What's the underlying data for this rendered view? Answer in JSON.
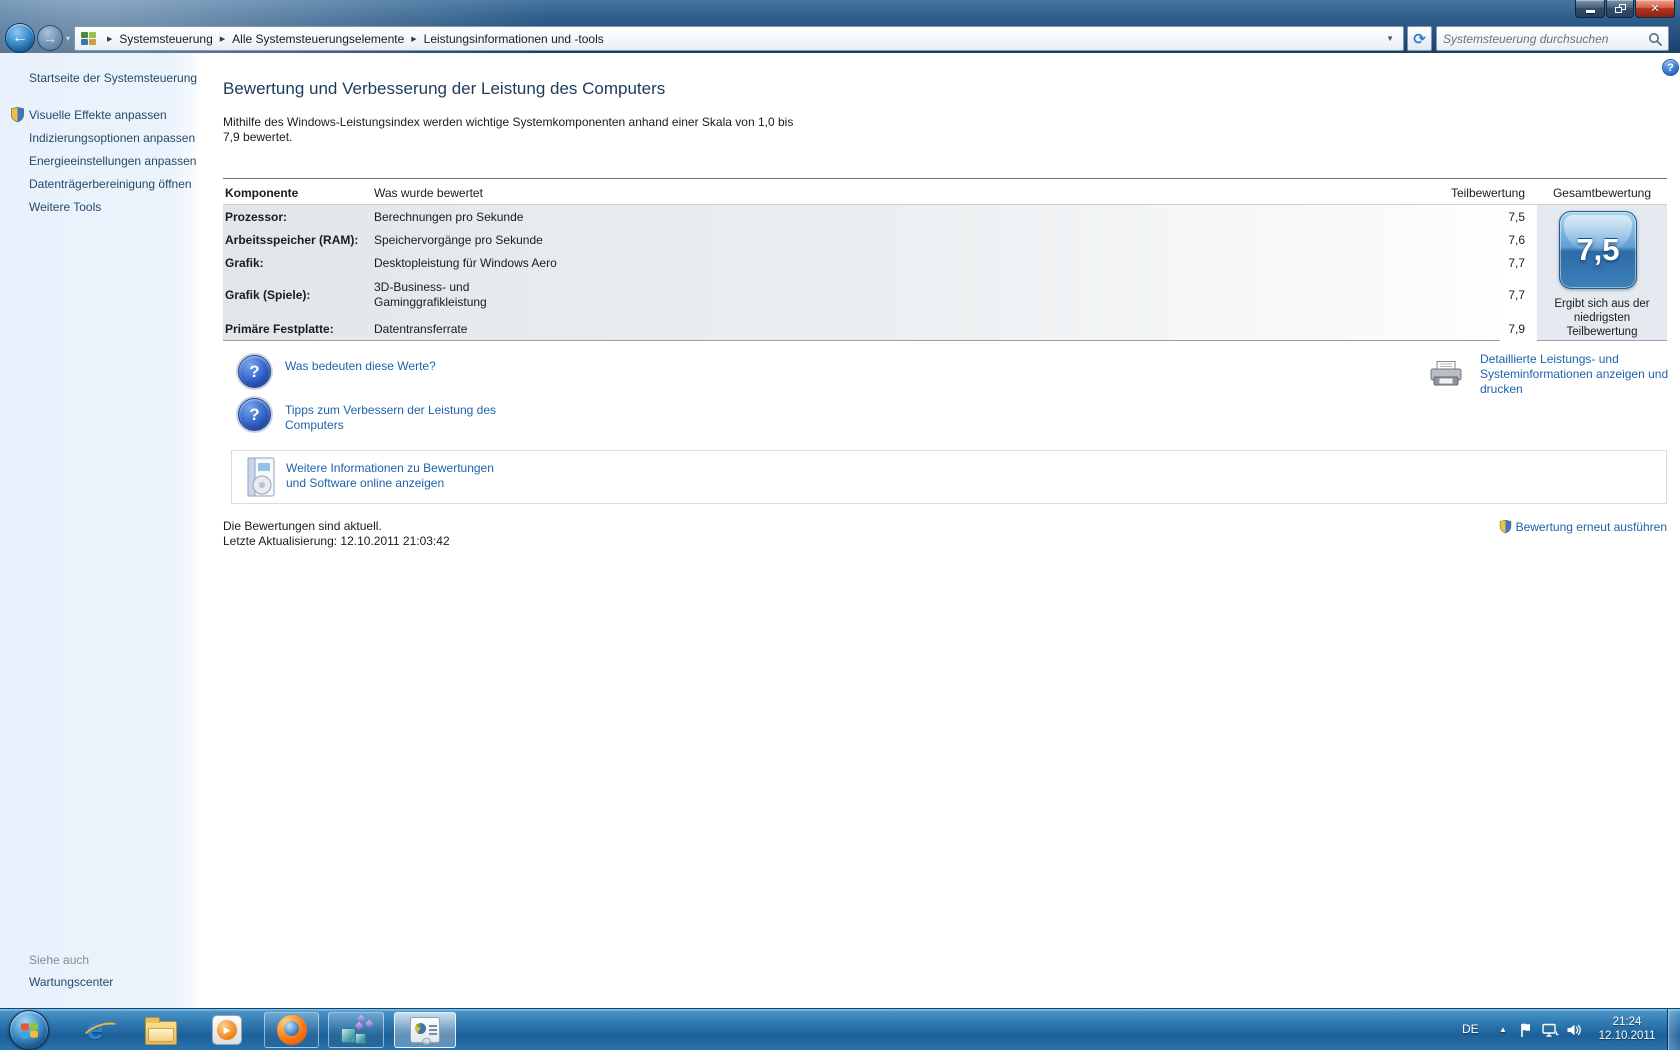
{
  "window": {
    "breadcrumb": {
      "items": [
        "Systemsteuerung",
        "Alle Systemsteuerungselemente",
        "Leistungsinformationen und -tools"
      ]
    },
    "search_placeholder": "Systemsteuerung durchsuchen"
  },
  "sidebar": {
    "home": "Startseite der Systemsteuerung",
    "tasks": [
      "Visuelle Effekte anpassen",
      "Indizierungsoptionen anpassen",
      "Energieeinstellungen anpassen",
      "Datenträgerbereinigung öffnen",
      "Weitere Tools"
    ],
    "see_also": {
      "header": "Siehe auch",
      "link": "Wartungscenter"
    }
  },
  "main": {
    "title": "Bewertung und Verbesserung der Leistung des Computers",
    "intro_line1": "Mithilfe des Windows-Leistungsindex werden wichtige Systemkomponenten anhand einer Skala von 1,0 bis",
    "intro_line2": "7,9 bewertet.",
    "table": {
      "headers": {
        "component": "Komponente",
        "assessed": "Was wurde bewertet",
        "subscore": "Teilbewertung",
        "total": "Gesamtbewertung"
      },
      "rows": [
        {
          "component": "Prozessor:",
          "assessed": "Berechnungen pro Sekunde",
          "subscore": "7,5"
        },
        {
          "component": "Arbeitsspeicher (RAM):",
          "assessed": "Speichervorgänge pro Sekunde",
          "subscore": "7,6"
        },
        {
          "component": "Grafik:",
          "assessed": "Desktopleistung für Windows Aero",
          "subscore": "7,7"
        },
        {
          "component": "Grafik (Spiele):",
          "assessed": "3D-Business- und Gaminggrafikleistung",
          "subscore": "7,7"
        },
        {
          "component": "Primäre Festplatte:",
          "assessed": "Datentransferrate",
          "subscore": "7,9"
        }
      ],
      "base_score": "7,5",
      "base_score_caption": "Ergibt sich aus der niedrigsten Teilbewertung"
    },
    "links": {
      "what_values": "Was bedeuten diese Werte?",
      "tips": "Tipps zum Verbessern der Leistung des Computers",
      "detailed": "Detaillierte Leistungs- und Systeminformationen anzeigen und drucken",
      "online": "Weitere Informationen zu Bewertungen und Software online anzeigen",
      "rerun": "Bewertung erneut ausführen"
    },
    "status": {
      "line1": "Die Bewertungen sind aktuell.",
      "line2": "Letzte Aktualisierung: 12.10.2011 21:03:42"
    }
  },
  "taskbar": {
    "language": "DE",
    "clock": {
      "time": "21:24",
      "date": "12.10.2011"
    }
  },
  "colors": {
    "link_blue": "#1e62ad",
    "chrome_blue": "#2f5e8c",
    "taskbar_blue": "#2f78b0",
    "badge_blue": "#3c80ba",
    "sidebar_bg": "#e9f2fc",
    "close_red": "#b23320"
  }
}
